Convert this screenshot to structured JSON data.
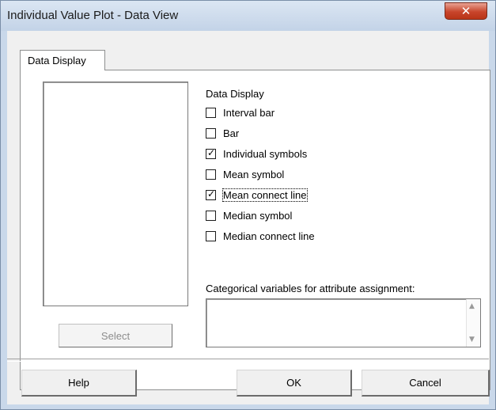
{
  "window": {
    "title": "Individual Value Plot - Data View",
    "close_glyph": "✕"
  },
  "tabs": [
    {
      "label": "Data Display",
      "active": true
    }
  ],
  "left": {
    "select_label": "Select",
    "select_enabled": false
  },
  "data_display": {
    "group_label": "Data Display",
    "options": [
      {
        "label": "Interval bar",
        "checked": false
      },
      {
        "label": "Bar",
        "checked": false
      },
      {
        "label": "Individual symbols",
        "checked": true
      },
      {
        "label": "Mean symbol",
        "checked": false
      },
      {
        "label": "Mean connect line",
        "checked": true,
        "focused": true
      },
      {
        "label": "Median symbol",
        "checked": false
      },
      {
        "label": "Median connect line",
        "checked": false
      }
    ],
    "check_glyph": "✓"
  },
  "categorical": {
    "label": "Categorical variables for attribute assignment:",
    "value": "",
    "scroll_up_glyph": "▲",
    "scroll_down_glyph": "▼"
  },
  "buttons": {
    "help": "Help",
    "ok": "OK",
    "cancel": "Cancel"
  },
  "colors": {
    "title_bar": "#c3d3e7",
    "close_button": "#c8452b",
    "dialog_face": "#f0f0f0"
  }
}
